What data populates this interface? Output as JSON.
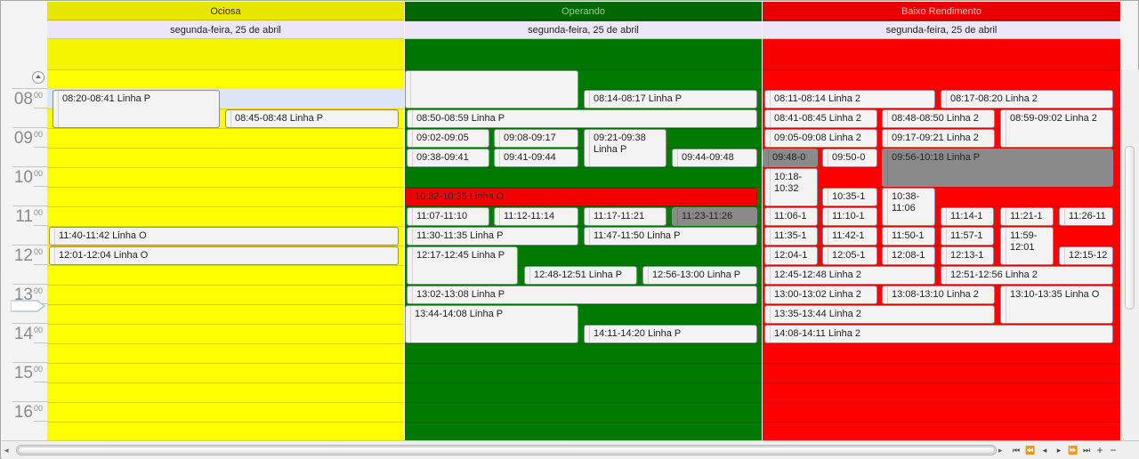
{
  "columns": [
    {
      "key": "ociosa",
      "title": "Ociosa",
      "date": "segunda-feira, 25 de abril",
      "bg": "#ffff00",
      "header_bg": "#e6e600",
      "allday_bg": "#f5f500",
      "line": "#d8d800",
      "title_color": "#333333"
    },
    {
      "key": "operando",
      "title": "Operando",
      "date": "segunda-feira, 25 de abril",
      "bg": "#007b00",
      "header_bg": "#006800",
      "allday_bg": "#007500",
      "line": "#006200",
      "title_color": "#8fd08f"
    },
    {
      "key": "baixo",
      "title": "Baixo Rendimento",
      "date": "segunda-feira, 25 de abril",
      "bg": "#ff0000",
      "header_bg": "#e60000",
      "allday_bg": "#f80000",
      "line": "#d60000",
      "title_color": "#ffb0b0"
    }
  ],
  "hours": [
    {
      "h": "08",
      "m": "00"
    },
    {
      "h": "09",
      "m": "00"
    },
    {
      "h": "10",
      "m": "00"
    },
    {
      "h": "11",
      "m": "00"
    },
    {
      "h": "12",
      "m": "00"
    },
    {
      "h": "13",
      "m": "00"
    },
    {
      "h": "14",
      "m": "00"
    },
    {
      "h": "15",
      "m": "00"
    },
    {
      "h": "16",
      "m": "00"
    }
  ],
  "appointments": {
    "ociosa": [
      "08:20-08:41 Linha P",
      "08:45-08:48 Linha P",
      "11:40-11:42 Linha O",
      "12:01-12:04 Linha O"
    ],
    "operando": [
      "",
      "08:14-08:17 Linha P",
      "08:50-08:59 Linha P",
      "09:02-09:05",
      "09:08-09:17",
      "09:21-09:38 Linha P",
      "09:38-09:41",
      "09:41-09:44",
      "09:44-09:48",
      "10:32-10:35 Linha O",
      "11:07-11:10",
      "11:12-11:14",
      "11:17-11:21",
      "11:23-11:26",
      "11:30-11:35 Linha P",
      "11:47-11:50 Linha P",
      "12:17-12:45 Linha P",
      "12:48-12:51 Linha P",
      "12:56-13:00 Linha P",
      "13:02-13:08 Linha P",
      "13:44-14:08 Linha P",
      "14:11-14:20 Linha P"
    ],
    "baixo": [
      "08:11-08:14 Linha 2",
      "08:17-08:20 Linha 2",
      "08:41-08:45 Linha 2",
      "08:48-08:50 Linha 2",
      "08:59-09:02 Linha 2",
      "09:05-09:08 Linha 2",
      "09:17-09:21 Linha 2",
      "09:48-0",
      "09:50-0",
      "09:56-10:18 Linha P",
      "10:18-10:32",
      "10:35-1",
      "10:38-11:06",
      "11:06-1",
      "11:10-1",
      "11:14-1",
      "11:21-1",
      "11:26-11",
      "11:35-1",
      "11:42-1",
      "11:50-1",
      "11:57-1",
      "11:59-12:01",
      "12:04-1",
      "12:05-1",
      "12:08-1",
      "12:13-1",
      "12:15-12",
      "12:45-12:48 Linha 2",
      "12:51-12:56 Linha 2",
      "13:00-13:02 Linha 2",
      "13:08-13:10 Linha 2",
      "13:10-13:35 Linha O",
      "13:35-13:44 Linha 2",
      "14:08-14:11 Linha 2"
    ]
  },
  "colors": {
    "gray_appt": "#8a8a8a",
    "red_appt": "#f20000",
    "appt_bg": "#f3f3f3",
    "lavender": "#dde6f6"
  },
  "nav_icons": [
    "first-icon",
    "prev-page-icon",
    "prev-icon",
    "next-icon",
    "next-page-icon",
    "last-icon",
    "zoom-in-icon",
    "zoom-out-icon"
  ],
  "nav_glyphs": [
    "⏮",
    "⏪",
    "◂",
    "▸",
    "⏩",
    "⏭",
    "+",
    "−"
  ]
}
